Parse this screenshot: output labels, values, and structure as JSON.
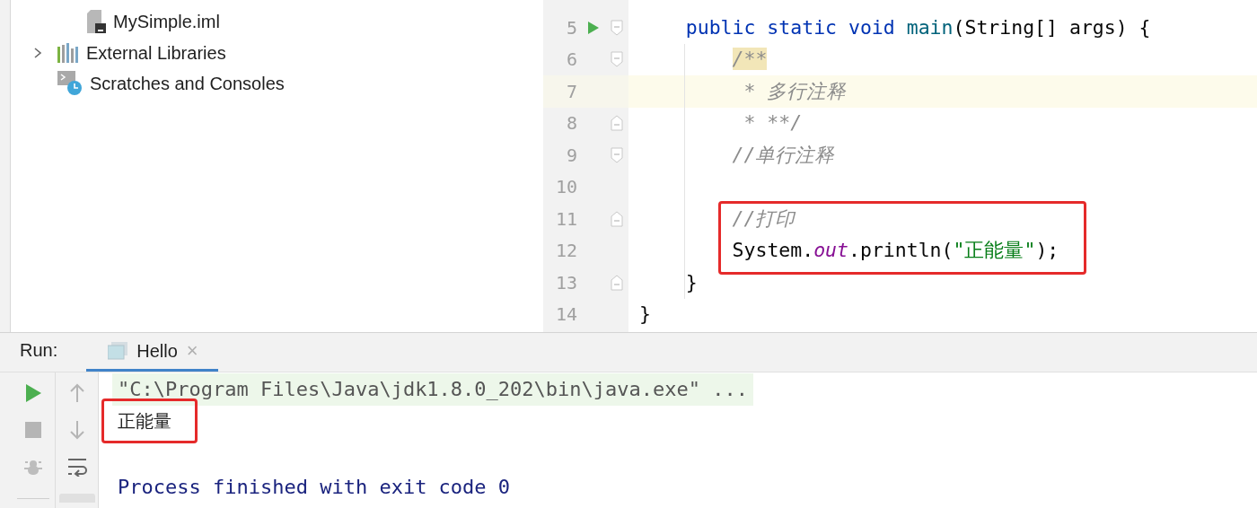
{
  "project_tree": [
    {
      "children": [
        {
          "label": "MySimple.iml",
          "kind": "iml"
        }
      ]
    },
    {
      "label": "External Libraries",
      "kind": "library",
      "expanded": false
    },
    {
      "label": "Scratches and Consoles",
      "kind": "scratches"
    }
  ],
  "editor": {
    "lines": [
      {
        "children": [
          {
            "number": "5",
            "run_marker": true,
            "fold_start": true,
            "tokens": [
              {
                "kind": "keyword",
                "text": "public static void "
              },
              {
                "kind": "function",
                "text": "main"
              },
              {
                "kind": "plain",
                "text": "(String[] args) {"
              }
            ],
            "children": [
              {
                "number": "6",
                "fold_start": true,
                "kind": "doc_start",
                "tokens": [
                  {
                    "kind": "comment-match",
                    "text": "/**"
                  }
                ],
                "children": [
                  {
                    "number": "7",
                    "current": true,
                    "tokens": [
                      {
                        "kind": "comment",
                        "text": "* 多行注释"
                      }
                    ]
                  },
                  {
                    "number": "8",
                    "fold_end": true,
                    "tokens": [
                      {
                        "kind": "comment",
                        "text": "* **/"
                      }
                    ]
                  }
                ]
              },
              {
                "number": "9",
                "fold_start": true,
                "tokens": [
                  {
                    "kind": "comment",
                    "text": "//单行注释"
                  }
                ]
              },
              {
                "number": "10"
              },
              {
                "number": "11",
                "fold_end": true,
                "tokens": [
                  {
                    "kind": "comment",
                    "text": "//打印"
                  }
                ]
              },
              {
                "number": "12",
                "tokens": [
                  {
                    "kind": "plain",
                    "text": "System."
                  },
                  {
                    "kind": "field",
                    "text": "out"
                  },
                  {
                    "kind": "plain",
                    "text": ".println("
                  },
                  {
                    "kind": "string",
                    "text": "\"正能量\""
                  },
                  {
                    "kind": "plain",
                    "text": ");"
                  }
                ]
              }
            ]
          },
          {
            "number": "13",
            "fold_end": true,
            "tokens": [
              {
                "kind": "plain",
                "text": "}"
              }
            ]
          }
        ]
      },
      {
        "number": "14",
        "tokens": [
          {
            "kind": "plain",
            "text": "}"
          }
        ]
      }
    ]
  },
  "run_panel": {
    "label": "Run:",
    "tabs": [
      {
        "label": "Hello",
        "selected": true,
        "close": "×"
      }
    ],
    "console": [
      {
        "kind": "command",
        "text": "\"C:\\Program Files\\Java\\jdk1.8.0_202\\bin\\java.exe\" ..."
      },
      {
        "kind": "output",
        "text": "正能量"
      },
      {
        "kind": "system",
        "text": "Process finished with exit code 0"
      }
    ]
  }
}
